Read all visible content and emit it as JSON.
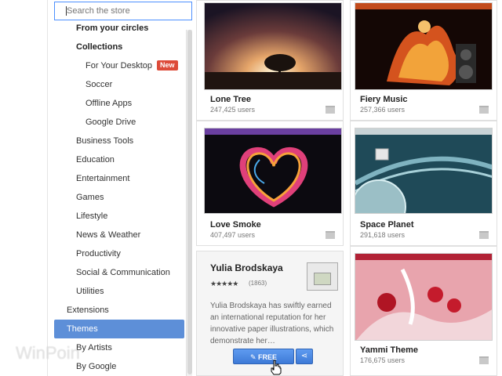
{
  "search": {
    "placeholder": "Search the store"
  },
  "sidebar": {
    "items": [
      {
        "label": "From your circles",
        "bold": true
      },
      {
        "label": "Collections",
        "bold": true
      },
      {
        "label": "For Your Desktop",
        "badge": "New"
      },
      {
        "label": "Soccer"
      },
      {
        "label": "Offline Apps"
      },
      {
        "label": "Google Drive"
      },
      {
        "label": "Business Tools"
      },
      {
        "label": "Education"
      },
      {
        "label": "Entertainment"
      },
      {
        "label": "Games"
      },
      {
        "label": "Lifestyle"
      },
      {
        "label": "News & Weather"
      },
      {
        "label": "Productivity"
      },
      {
        "label": "Social & Communication"
      },
      {
        "label": "Utilities"
      },
      {
        "label": "Extensions"
      },
      {
        "label": "Themes",
        "selected": true
      },
      {
        "label": "By Artists"
      },
      {
        "label": "By Google"
      }
    ]
  },
  "themes": [
    {
      "title": "Lone Tree",
      "users": "247,425 users"
    },
    {
      "title": "Fiery Music",
      "users": "257,366 users"
    },
    {
      "title": "Love Smoke",
      "users": "407,497 users"
    },
    {
      "title": "Space Planet",
      "users": "291,618 users"
    },
    {
      "title": "Yammi Theme",
      "users": "176,675 users"
    }
  ],
  "author": {
    "name": "Yulia Brodskaya",
    "stars": "★★★★★",
    "rating_count": "(1863)",
    "description": "Yulia Brodskaya has swiftly earned an international reputation for her innovative paper illustrations, which demonstrate her…",
    "free_label": "FREE"
  },
  "watermark": "WinPoin",
  "colors": {
    "accent": "#5d8fd8",
    "badge": "#dd4b39",
    "button": "#4a86e0"
  }
}
